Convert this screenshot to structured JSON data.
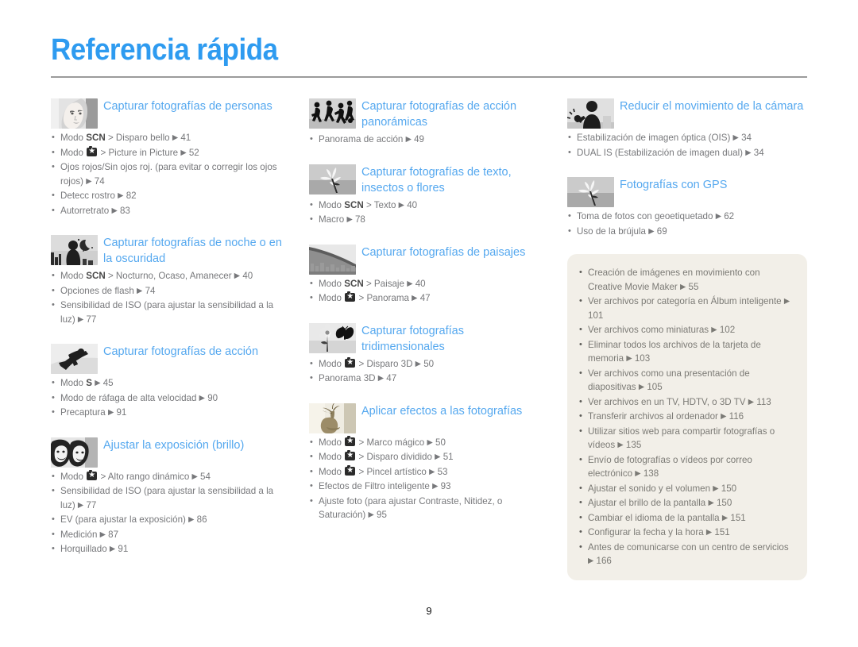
{
  "page": {
    "title": "Referencia rápida",
    "folio": "9",
    "accent_title_color": "#2e9bf0",
    "accent_heading_color": "#55a8ef",
    "body_text_color": "#77787b",
    "box_background_color": "#f2efe8"
  },
  "columns": [
    {
      "id": "column-left",
      "sections": [
        {
          "icon": "portrait-woman-thumbnail",
          "title": "Capturar fotografías de personas",
          "items": [
            {
              "pre": "Modo ",
              "bold": "SCN",
              "mid": " > Disparo bello ",
              "page": "41"
            },
            {
              "pre": "Modo ",
              "camera": true,
              "mid": " > Picture in Picture ",
              "page": "52"
            },
            {
              "pre": "Ojos rojos/Sin ojos roj. (para evitar o corregir los ojos rojos) ",
              "page": "74"
            },
            {
              "pre": "Detecc rostro ",
              "page": "82"
            },
            {
              "pre": "Autorretrato ",
              "page": "83"
            }
          ]
        },
        {
          "icon": "night-silhouette-moon-thumbnail",
          "title": "Capturar fotografías de noche o en la oscuridad",
          "items": [
            {
              "pre": "Modo ",
              "bold": "SCN",
              "mid": " > Nocturno, Ocaso, Amanecer ",
              "page": "40"
            },
            {
              "pre": "Opciones de flash ",
              "page": "74"
            },
            {
              "pre": "Sensibilidad de ISO (para ajustar la sensibilidad a la luz) ",
              "page": "77"
            }
          ]
        },
        {
          "icon": "snowboarder-action-thumbnail",
          "title": "Capturar fotografías de acción",
          "items": [
            {
              "pre": "Modo ",
              "bold": "S",
              "mid": " ",
              "page": "45"
            },
            {
              "pre": "Modo de ráfaga de alta velocidad ",
              "page": "90"
            },
            {
              "pre": "Precaptura ",
              "page": "91"
            }
          ]
        },
        {
          "icon": "two-faces-exposure-thumbnail",
          "title": "Ajustar la exposición (brillo)",
          "items": [
            {
              "pre": "Modo ",
              "camera": true,
              "mid": " > Alto rango dinámico ",
              "page": "54"
            },
            {
              "pre": "Sensibilidad de ISO (para ajustar la sensibilidad a la luz) ",
              "page": "77"
            },
            {
              "pre": "EV (para ajustar la exposición) ",
              "page": "86"
            },
            {
              "pre": "Medición ",
              "page": "87"
            },
            {
              "pre": "Horquillado ",
              "page": "91"
            }
          ]
        }
      ]
    },
    {
      "id": "column-middle",
      "sections": [
        {
          "icon": "running-people-panorama-thumbnail",
          "title": "Capturar fotografías de acción panorámicas",
          "items": [
            {
              "pre": "Panorama de acción ",
              "page": "49"
            }
          ]
        },
        {
          "icon": "flower-macro-thumbnail",
          "title": "Capturar fotografías de texto, insectos o flores",
          "items": [
            {
              "pre": "Modo ",
              "bold": "SCN",
              "mid": " > Texto ",
              "page": "40"
            },
            {
              "pre": "Macro ",
              "page": "78"
            }
          ]
        },
        {
          "icon": "bridge-landscape-thumbnail",
          "title": "Capturar fotografías de paisajes",
          "items": [
            {
              "pre": "Modo ",
              "bold": "SCN",
              "mid": " > Paisaje ",
              "page": "40"
            },
            {
              "pre": "Modo ",
              "camera": true,
              "mid": " > Panorama ",
              "page": "47"
            }
          ]
        },
        {
          "icon": "butterfly-flower-3d-thumbnail",
          "title": "Capturar fotografías tridimensionales",
          "items": [
            {
              "pre": "Modo ",
              "camera": true,
              "mid": " > Disparo 3D ",
              "page": "50"
            },
            {
              "pre": "Panorama 3D ",
              "page": "47"
            }
          ]
        },
        {
          "icon": "vase-effects-thumbnail",
          "title": "Aplicar efectos a las fotografías",
          "items": [
            {
              "pre": "Modo ",
              "camera": true,
              "mid": " > Marco mágico ",
              "page": "50"
            },
            {
              "pre": "Modo ",
              "camera": true,
              "mid": " > Disparo dividido ",
              "page": "51"
            },
            {
              "pre": "Modo ",
              "camera": true,
              "mid": " > Pincel artístico ",
              "page": "53"
            },
            {
              "pre": "Efectos de Filtro inteligente ",
              "page": "93"
            },
            {
              "pre": "Ajuste foto (para ajustar Contraste, Nitidez, o Saturación) ",
              "page": "95"
            }
          ]
        }
      ]
    },
    {
      "id": "column-right",
      "sections": [
        {
          "icon": "person-shake-reduction-thumbnail",
          "title": "Reducir el movimiento de la cámara",
          "items": [
            {
              "pre": "Estabilización de imagen óptica (OIS) ",
              "page": "34"
            },
            {
              "pre": "DUAL IS (Estabilización de imagen dual) ",
              "page": "34"
            }
          ]
        },
        {
          "icon": "flower-gps-thumbnail",
          "title": "Fotografías con GPS",
          "items": [
            {
              "pre": "Toma de fotos con geoetiquetado ",
              "page": "62"
            },
            {
              "pre": "Uso de la brújula ",
              "page": "69"
            }
          ]
        }
      ],
      "box_items": [
        {
          "pre": "Creación de imágenes en movimiento con Creative Movie Maker ",
          "page": "55"
        },
        {
          "pre": "Ver archivos por categoría en Álbum inteligente ",
          "page": "101"
        },
        {
          "pre": "Ver archivos como miniaturas ",
          "page": "102"
        },
        {
          "pre": "Eliminar todos los archivos de la tarjeta de memoria ",
          "page": "103"
        },
        {
          "pre": "Ver archivos como una presentación de diapositivas ",
          "page": "105"
        },
        {
          "pre": "Ver archivos en un TV, HDTV, o 3D TV ",
          "page": "113"
        },
        {
          "pre": "Transferir archivos al ordenador ",
          "page": "116"
        },
        {
          "pre": "Utilizar sitios web para compartir fotografías o vídeos ",
          "page": "135"
        },
        {
          "pre": "Envío de fotografías o vídeos por correo electrónico ",
          "page": "138"
        },
        {
          "pre": "Ajustar el sonido y el volumen ",
          "page": "150"
        },
        {
          "pre": "Ajustar el brillo de la pantalla ",
          "page": "150"
        },
        {
          "pre": "Cambiar el idioma de la pantalla ",
          "page": "151"
        },
        {
          "pre": "Configurar la fecha y la hora ",
          "page": "151"
        },
        {
          "pre": "Antes de comunicarse con un centro de servicios ",
          "page": "166"
        }
      ]
    }
  ]
}
